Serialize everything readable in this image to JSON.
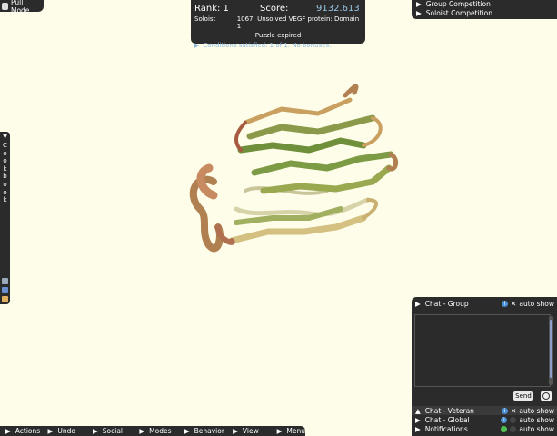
{
  "pull_mode": {
    "label": "Pull Mode",
    "icon": "hand-icon"
  },
  "score_panel": {
    "rank": "Rank: 1",
    "score_label": "Score:",
    "score_value": "9132.613",
    "role": "Soloist",
    "puzzle_name": "1067: Unsolved VEGF protein: Domain 1",
    "status": "Puzzle expired",
    "conditions": "Conditions satisfied: 1 of 1. No bonuses."
  },
  "competitions": {
    "group": "Group Competition",
    "soloist": "Soloist Competition"
  },
  "cookbook": {
    "letters": [
      "C",
      "o",
      "o",
      "k",
      "b",
      "o",
      "o",
      "k"
    ],
    "tools": [
      "recipe-icon",
      "edit-icon",
      "note-icon"
    ]
  },
  "chat": {
    "group_label": "Chat - Group",
    "auto_show": "auto show",
    "send_label": "Send",
    "veteran_label": "Chat - Veteran",
    "global_label": "Chat - Global",
    "notifications_label": "Notifications",
    "colors": {
      "info": "#4b8fd4",
      "notify": "#4fbf4f"
    }
  },
  "menu": {
    "items": [
      "Actions",
      "Undo",
      "Social",
      "Modes",
      "Behavior",
      "View",
      "Menu"
    ]
  },
  "colors": {
    "background": "#fdfde9",
    "panel": "#2b2b2b",
    "score": "#9cc7e6"
  }
}
